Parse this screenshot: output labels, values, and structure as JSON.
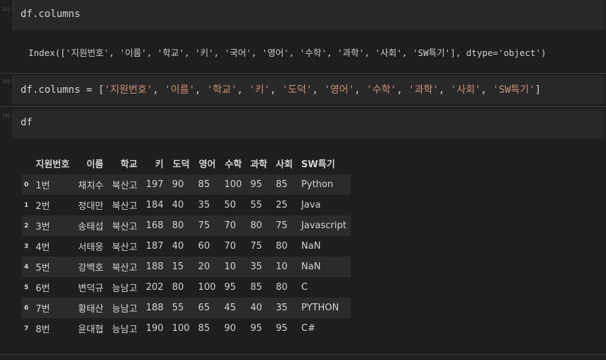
{
  "cells": [
    {
      "prompt": "[2]:",
      "code": "df.columns"
    },
    {
      "prompt": "[3]:",
      "code_prefix": "df.columns = [",
      "strings": [
        "'지원번호'",
        "'이름'",
        "'학교'",
        "'키'",
        "'도덕'",
        "'영어'",
        "'수학'",
        "'과학'",
        "'사회'",
        "'SW특기'"
      ],
      "code_suffix": "]"
    },
    {
      "prompt": "[4]:",
      "code": "df"
    }
  ],
  "output_index": "Index(['지원번호', '이름', '학교', '키', '국어', '영어', '수학', '과학', '사회', 'SW특기'], dtype='object')",
  "table": {
    "columns": [
      "지원번호",
      "이름",
      "학교",
      "키",
      "도덕",
      "영어",
      "수학",
      "과학",
      "사회",
      "SW특기"
    ],
    "rows": [
      {
        "idx": "0",
        "cells": [
          "1번",
          "채치수",
          "북산고",
          "197",
          "90",
          "85",
          "100",
          "95",
          "85",
          "Python"
        ]
      },
      {
        "idx": "1",
        "cells": [
          "2번",
          "정대만",
          "북산고",
          "184",
          "40",
          "35",
          "50",
          "55",
          "25",
          "Java"
        ]
      },
      {
        "idx": "2",
        "cells": [
          "3번",
          "송태섭",
          "북산고",
          "168",
          "80",
          "75",
          "70",
          "80",
          "75",
          "Javascript"
        ]
      },
      {
        "idx": "3",
        "cells": [
          "4번",
          "서태웅",
          "북산고",
          "187",
          "40",
          "60",
          "70",
          "75",
          "80",
          "NaN"
        ]
      },
      {
        "idx": "4",
        "cells": [
          "5번",
          "강백호",
          "북산고",
          "188",
          "15",
          "20",
          "10",
          "35",
          "10",
          "NaN"
        ]
      },
      {
        "idx": "5",
        "cells": [
          "6번",
          "변덕규",
          "능남고",
          "202",
          "80",
          "100",
          "95",
          "85",
          "80",
          "C"
        ]
      },
      {
        "idx": "6",
        "cells": [
          "7번",
          "황태산",
          "능남고",
          "188",
          "55",
          "65",
          "45",
          "40",
          "35",
          "PYTHON"
        ]
      },
      {
        "idx": "7",
        "cells": [
          "8번",
          "윤대협",
          "능남고",
          "190",
          "100",
          "85",
          "90",
          "95",
          "95",
          "C#"
        ]
      }
    ]
  }
}
